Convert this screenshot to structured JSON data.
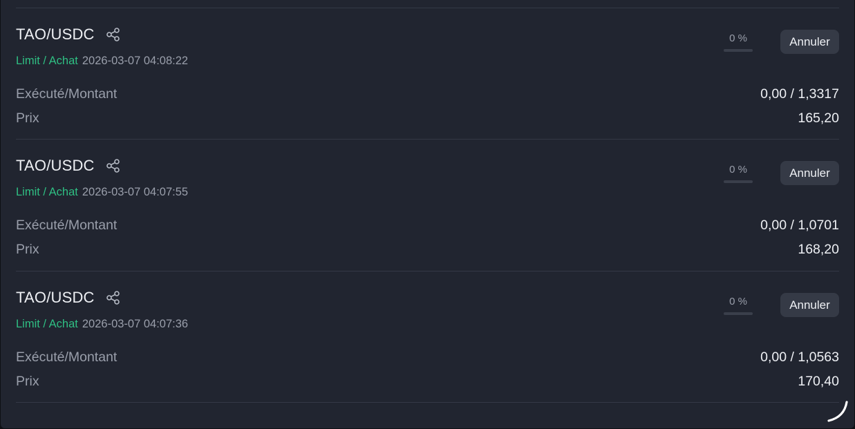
{
  "labels": {
    "executed_amount": "Exécuté/Montant",
    "price": "Prix",
    "cancel": "Annuler"
  },
  "colors": {
    "panel_bg": "#212530",
    "order_type": "#2fbf83",
    "muted_text": "#9a9fab",
    "primary_text": "#eef0f4",
    "button_bg": "#353a46"
  },
  "orders": [
    {
      "pair": "TAO/USDC",
      "type": "Limit / Achat",
      "date": "2026-03-07 04:08:22",
      "fill_percent": "0 %",
      "fill_fraction": 0,
      "executed_amount": "0,00 / 1,3317",
      "price": "165,20"
    },
    {
      "pair": "TAO/USDC",
      "type": "Limit / Achat",
      "date": "2026-03-07 04:07:55",
      "fill_percent": "0 %",
      "fill_fraction": 0,
      "executed_amount": "0,00 / 1,0701",
      "price": "168,20"
    },
    {
      "pair": "TAO/USDC",
      "type": "Limit / Achat",
      "date": "2026-03-07 04:07:36",
      "fill_percent": "0 %",
      "fill_fraction": 0,
      "executed_amount": "0,00 / 1,0563",
      "price": "170,40"
    }
  ],
  "icons": {
    "share": "share-icon",
    "loading": "loading-spinner-icon"
  }
}
